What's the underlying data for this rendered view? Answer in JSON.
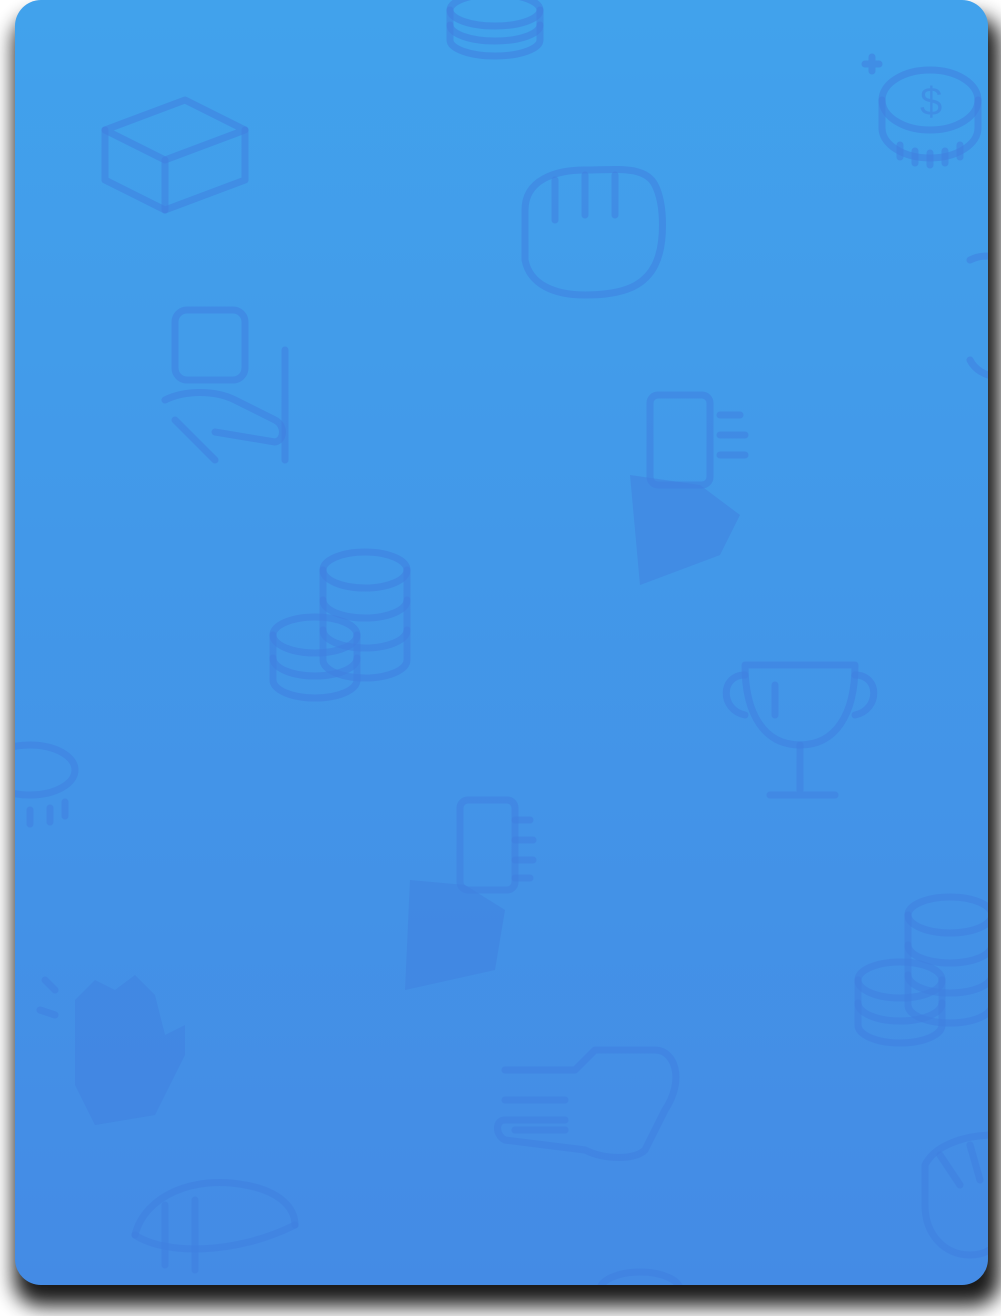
{
  "colors": {
    "card_top": "#41a2ec",
    "card_bottom": "#448be5",
    "pattern": "#3f7fe0",
    "shadow": "#000000",
    "page_background": "#ffffff"
  },
  "card": {
    "pattern_icons": [
      "coin-stack-icon",
      "coin-with-dollar-icon",
      "hand-holding-icon",
      "pointing-hand-icon",
      "phone-in-hand-icon",
      "trophy-icon",
      "waving-hands-icon",
      "medal-cup-icon"
    ]
  }
}
